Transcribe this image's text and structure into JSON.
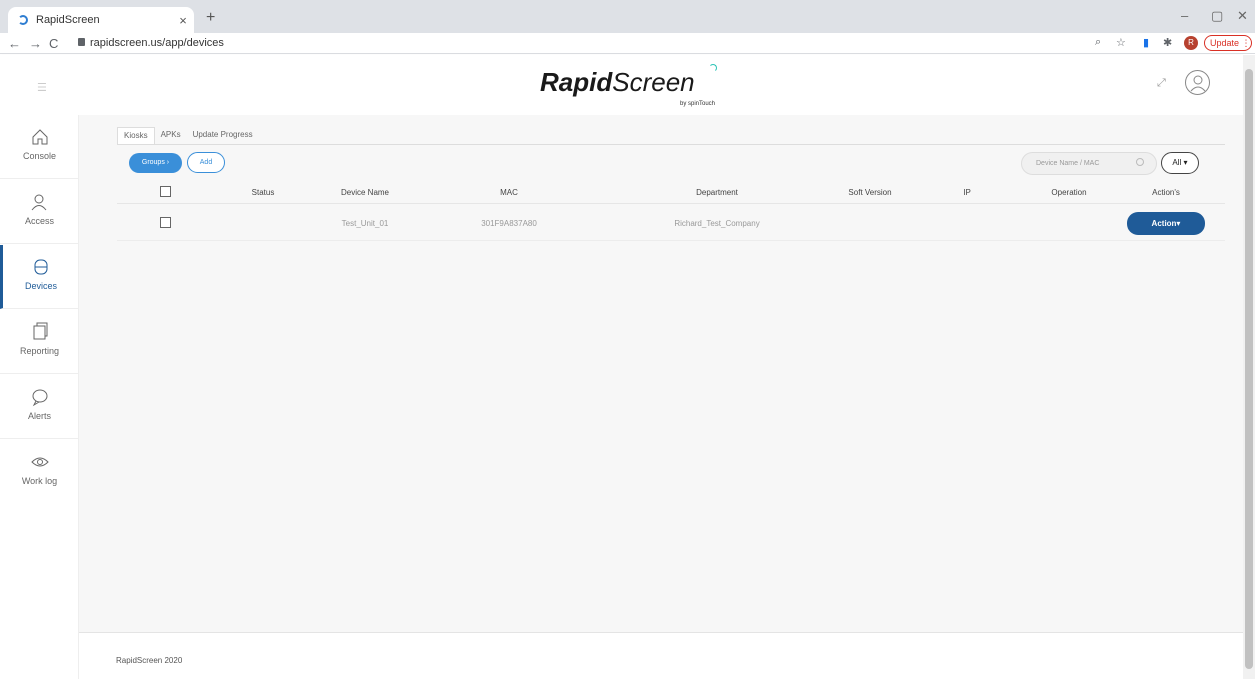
{
  "browser": {
    "tab_title": "RapidScreen",
    "tab_close": "×",
    "new_tab": "+",
    "url": "rapidscreen.us/app/devices",
    "back": "←",
    "forward": "→",
    "reload": "C",
    "profile_initial": "R",
    "update_label": "Update",
    "minimize": "–",
    "restore": "▢",
    "close": "✕"
  },
  "header": {
    "logo_bold": "Rapid",
    "logo_light": "Screen",
    "logo_sub": "by spinTouch"
  },
  "sidebar": {
    "items": [
      {
        "label": "Console",
        "icon": "home-icon"
      },
      {
        "label": "Access",
        "icon": "users-icon"
      },
      {
        "label": "Devices",
        "icon": "devices-icon"
      },
      {
        "label": "Reporting",
        "icon": "reporting-icon"
      },
      {
        "label": "Alerts",
        "icon": "chat-icon"
      },
      {
        "label": "Work log",
        "icon": "eye-icon"
      }
    ]
  },
  "main": {
    "tabs": [
      {
        "label": "Kiosks"
      },
      {
        "label": "APKs"
      },
      {
        "label": "Update Progress"
      }
    ],
    "groups_label": "Groups ›",
    "add_label": "Add",
    "search_placeholder": "Device Name / MAC",
    "filter_value": "All ▾",
    "columns": [
      "Status",
      "Device Name",
      "MAC",
      "Department",
      "Soft Version",
      "IP",
      "Operation",
      "Action's"
    ],
    "rows": [
      {
        "status": "",
        "device_name": "Test_Unit_01",
        "mac": "301F9A837A80",
        "department": "Richard_Test_Company",
        "soft_version": "",
        "ip": "",
        "operation": "",
        "action_label": "Action▾"
      }
    ]
  },
  "footer": {
    "text": "RapidScreen 2020"
  },
  "colors": {
    "primary": "#1f5b98",
    "accent": "#3a8fd9"
  }
}
